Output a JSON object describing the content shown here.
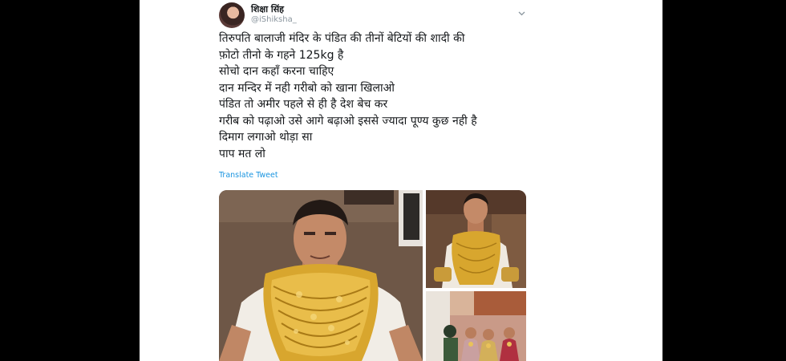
{
  "tweet": {
    "author": {
      "display_name": "शिक्षा सिंह",
      "handle": "@iShiksha_"
    },
    "lines": [
      "तिरुपति बालाजी मंदिर के पंडित की तीनों बेटियों की शादी की",
      "फ़ोटो तीनो के गहने 125kg है",
      "सोचो दान कहाँ करना चाहिए",
      "दान मन्दिर में नही गरीबो को खाना खिलाओ",
      "पंडित तो अमीर पहले से ही है देश बेच कर",
      "गरीब को पढ़ाओ उसे आगे बढ़ाओ इससे ज्यादा पूण्य कुछ नही है",
      "दिमाग लगाओ थोड़ा सा",
      "पाप मत लो"
    ],
    "translate_label": "Translate Tweet"
  },
  "icons": {
    "menu": "chevron-down-icon"
  },
  "colors": {
    "link": "#1b95e0",
    "text": "#14171a",
    "muted": "#8a959e",
    "background": "#000000"
  }
}
